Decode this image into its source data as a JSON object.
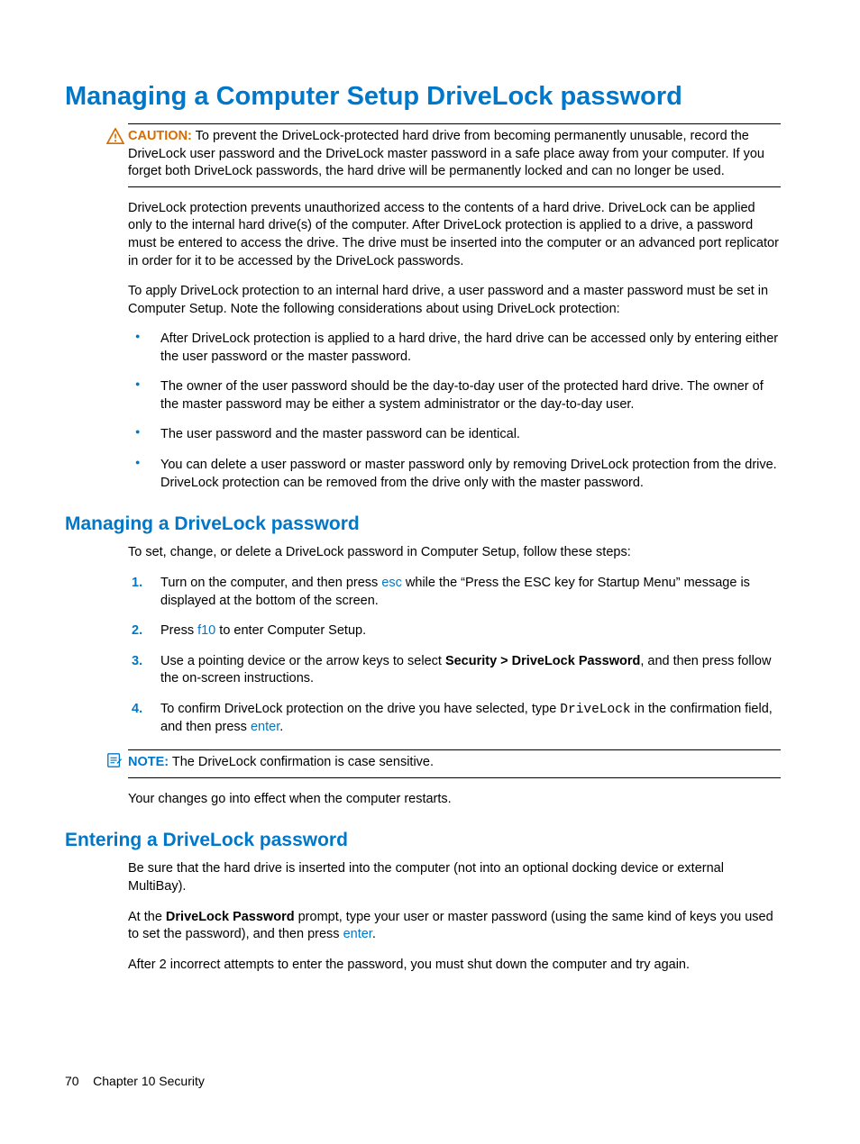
{
  "title": "Managing a Computer Setup DriveLock password",
  "caution": {
    "label": "CAUTION:",
    "text": "To prevent the DriveLock-protected hard drive from becoming permanently unusable, record the DriveLock user password and the DriveLock master password in a safe place away from your computer. If you forget both DriveLock passwords, the hard drive will be permanently locked and can no longer be used."
  },
  "intro_p1": "DriveLock protection prevents unauthorized access to the contents of a hard drive. DriveLock can be applied only to the internal hard drive(s) of the computer. After DriveLock protection is applied to a drive, a password must be entered to access the drive. The drive must be inserted into the computer or an advanced port replicator in order for it to be accessed by the DriveLock passwords.",
  "intro_p2": "To apply DriveLock protection to an internal hard drive, a user password and a master password must be set in Computer Setup. Note the following considerations about using DriveLock protection:",
  "bullets": [
    "After DriveLock protection is applied to a hard drive, the hard drive can be accessed only by entering either the user password or the master password.",
    "The owner of the user password should be the day-to-day user of the protected hard drive. The owner of the master password may be either a system administrator or the day-to-day user.",
    "The user password and the master password can be identical.",
    "You can delete a user password or master password only by removing DriveLock protection from the drive. DriveLock protection can be removed from the drive only with the master password."
  ],
  "section1": {
    "heading": "Managing a DriveLock password",
    "intro": "To set, change, or delete a DriveLock password in Computer Setup, follow these steps:",
    "step1_a": "Turn on the computer, and then press ",
    "step1_key": "esc",
    "step1_b": " while the “Press the ESC key for Startup Menu” message is displayed at the bottom of the screen.",
    "step2_a": "Press ",
    "step2_key": "f10",
    "step2_b": " to enter Computer Setup.",
    "step3_a": "Use a pointing device or the arrow keys to select ",
    "step3_bold": "Security > DriveLock Password",
    "step3_b": ", and then press follow the on-screen instructions.",
    "step4_a": "To confirm DriveLock protection on the drive you have selected, type ",
    "step4_code": "DriveLock",
    "step4_b": " in the confirmation field, and then press ",
    "step4_key": "enter",
    "step4_c": ".",
    "note_label": "NOTE:",
    "note_text": "The DriveLock confirmation is case sensitive.",
    "outro": "Your changes go into effect when the computer restarts."
  },
  "section2": {
    "heading": "Entering a DriveLock password",
    "p1": "Be sure that the hard drive is inserted into the computer (not into an optional docking device or external MultiBay).",
    "p2_a": "At the ",
    "p2_bold": "DriveLock Password",
    "p2_b": " prompt, type your user or master password (using the same kind of keys you used to set the password), and then press ",
    "p2_key": "enter",
    "p2_c": ".",
    "p3": "After 2 incorrect attempts to enter the password, you must shut down the computer and try again."
  },
  "footer": {
    "page": "70",
    "chapter": "Chapter 10   Security"
  }
}
